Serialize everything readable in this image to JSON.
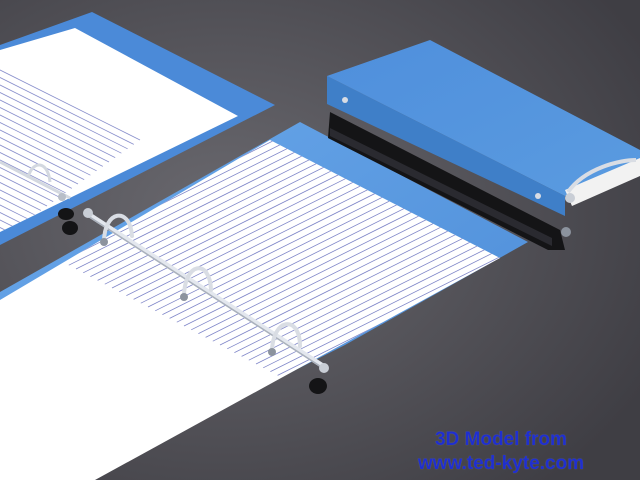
{
  "watermark": {
    "line1": "3D Model from",
    "line2": "www.ted-kyte.com"
  },
  "scene": {
    "subject": "three ring binders with lined paper",
    "colors": {
      "background": "#55545a",
      "cover_blue": "#5a9be0",
      "cover_edge": "#3f7fc8",
      "paper": "#ffffff",
      "rule_line": "#7f86c8",
      "ring_metal": "#cfd4dc",
      "spine_black": "#141416",
      "watermark_text": "#1f2fd0"
    },
    "icons": [
      "binder-ring-icon",
      "rivet-icon"
    ]
  }
}
